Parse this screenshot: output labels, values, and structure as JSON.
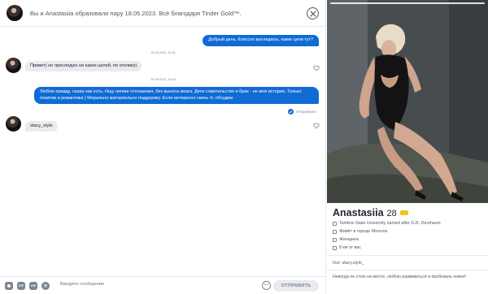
{
  "chat_header": {
    "match_text": "Вы и Anastasiia образовали пару 18.05.2023. Всё благодаря Tinder Gold™."
  },
  "messages": {
    "ts1": "18.05.2023, 19:51",
    "out1": "Добрый день. Классно выглядишь, какие цели тут?",
    "in1": "Привет) не преследую ни каких целей, по отклику)",
    "ts2": "29.05.2023, 13:45",
    "out2": "Люблю правду, скажу как есть. Ищу легкие отношения, без выноса мозга. Дети сожительство и брак - не моя история. Только позитив и романтика ) Морально материально поддержку. Если интересно скинь тг, обсудим",
    "status": "Отправлено",
    "in2": "stacy_style"
  },
  "composer": {
    "tools": [
      "GIF",
      "GIF"
    ],
    "placeholder": "Введите сообщение",
    "send_label": "ОТПРАВИТЬ"
  },
  "profile": {
    "name": "Anastasiia",
    "age": "28",
    "university": "Tambov State University named after G.R. Derzhavin",
    "city": "Живёт в городе Moscow",
    "gender": "Женщина",
    "distance": "8 км от вас",
    "bio1": "Inst: stacy.style_",
    "bio2": "Никогда не стою на месте, люблю развиваться и пробовать новое!"
  },
  "colors": {
    "accent": "#106bd5",
    "gold": "#f4c21d"
  }
}
